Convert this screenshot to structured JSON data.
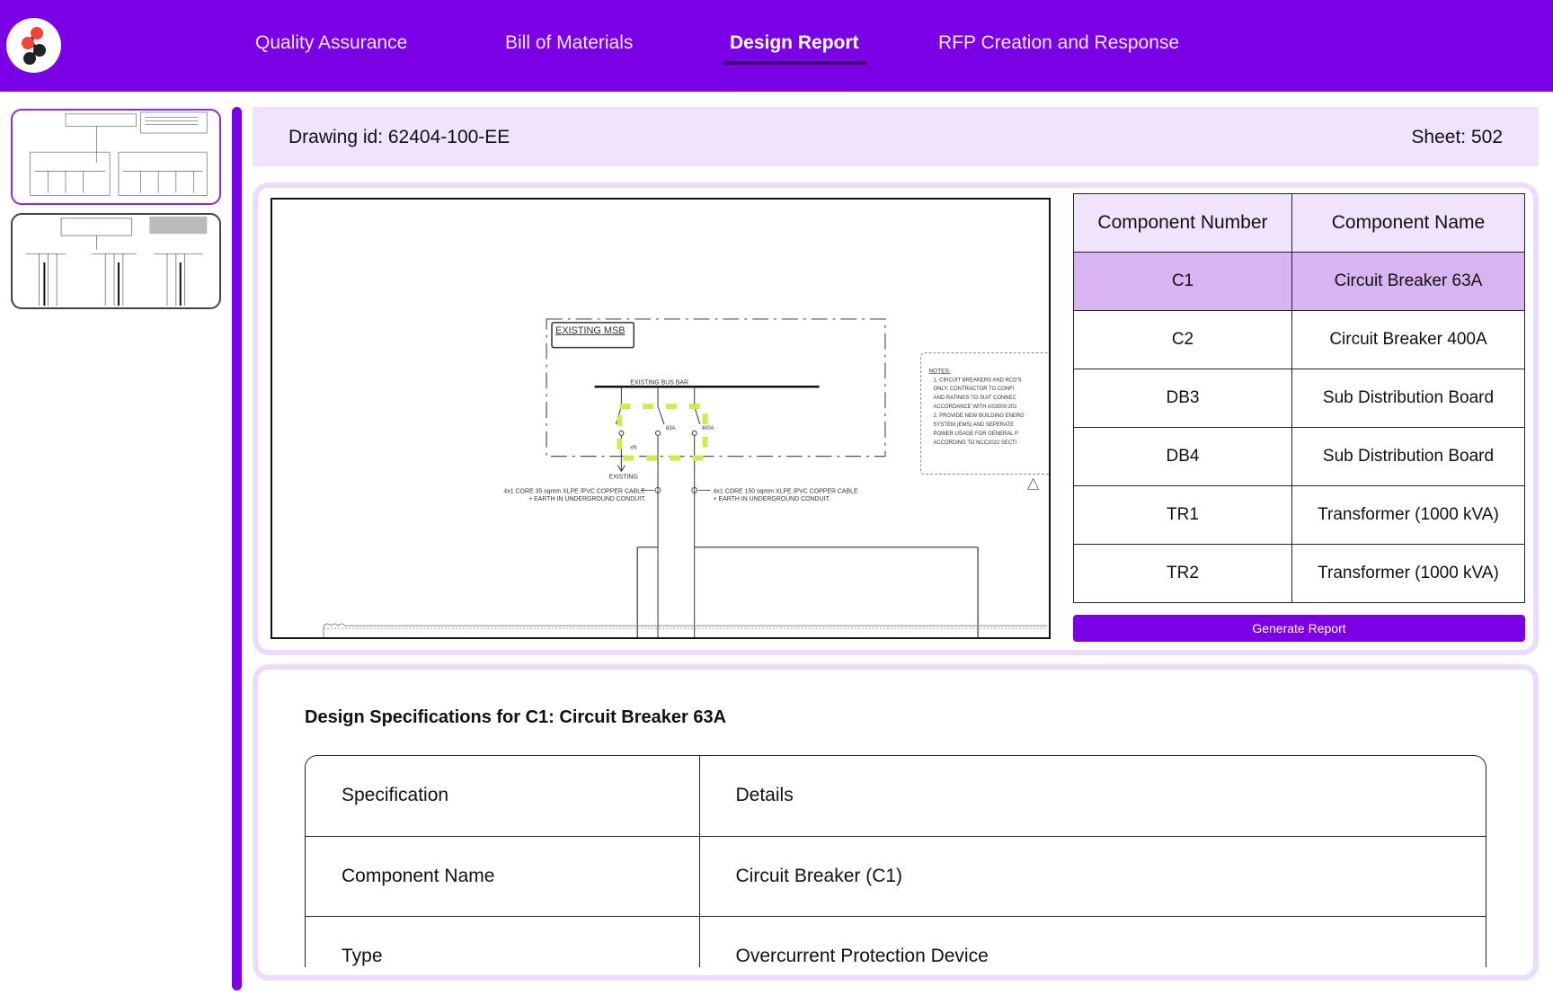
{
  "nav": {
    "items": [
      {
        "label": "Quality Assurance"
      },
      {
        "label": "Bill of Materials"
      },
      {
        "label": "Design Report"
      },
      {
        "label": "RFP Creation and Response"
      }
    ],
    "active": "Design Report"
  },
  "drawing": {
    "id_label": "Drawing id: 62404-100-EE",
    "sheet_label": "Sheet: 502",
    "labels": {
      "msb": "EXISTING MSB",
      "busbar": "EXISTING BUS BAR",
      "a63": "63A",
      "a400": "400A",
      "existing": "EXISTING",
      "xn": "xN",
      "cable1_l1": "4x1 CORE 35 sqmm XLPE /PVC COPPER CABLE",
      "cable1_l2": "+ EARTH IN UNDERGROUND CONDUIT.",
      "cable2_l1": "4x1 CORE 150 sqmm XLPE /PVC COPPER CABLE",
      "cable2_l2": "+ EARTH IN UNDERGROUND CONDUIT.",
      "notes_title": "NOTES:",
      "notes": [
        "1.   CIRCUIT BREAKERS AND RCD'S",
        "      ONLY. CONTRACTOR TO CONFI",
        "      AND RATINGS TO SUIT CONNEC",
        "      ACCORDANCE WITH AS3000:201",
        "2.   PROVIDE NEW BUILDING ENERG",
        "      SYSTEM (EMS) AND SEPERATE",
        "      POWER USAGE FOR GENERAL P",
        "      ACCORDING TO NCC2022 SECTI"
      ]
    }
  },
  "components": {
    "headers": [
      "Component Number",
      "Component Name"
    ],
    "rows": [
      {
        "number": "C1",
        "name": "Circuit Breaker 63A"
      },
      {
        "number": "C2",
        "name": "Circuit Breaker 400A"
      },
      {
        "number": "DB3",
        "name": "Sub Distribution Board"
      },
      {
        "number": "DB4",
        "name": "Sub Distribution Board"
      },
      {
        "number": "TR1",
        "name": "Transformer (1000 kVA)"
      },
      {
        "number": "TR2",
        "name": "Transformer (1000 kVA)"
      }
    ],
    "selected": "C1",
    "generate_label": "Generate Report"
  },
  "specs": {
    "title": "Design Specifications for C1: Circuit Breaker 63A",
    "rows": [
      {
        "spec": "Specification",
        "detail": "Details"
      },
      {
        "spec": "Component Name",
        "detail": "Circuit Breaker (C1)"
      },
      {
        "spec": "Type",
        "detail": "Overcurrent Protection Device"
      }
    ]
  },
  "colors": {
    "brand": "#7a00e6",
    "header_bg": "#efe4fb",
    "selected_row": "#d8b4f0",
    "highlight": "#c8f04a"
  }
}
